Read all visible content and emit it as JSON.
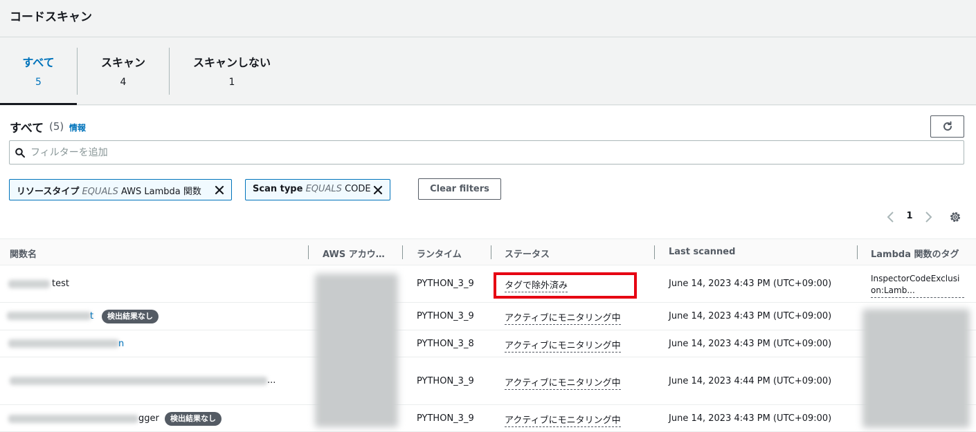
{
  "page": {
    "title": "コードスキャン"
  },
  "tabs": [
    {
      "label": "すべて",
      "count": "5"
    },
    {
      "label": "スキャン",
      "count": "4"
    },
    {
      "label": "スキャンしない",
      "count": "1"
    }
  ],
  "panel": {
    "title": "すべて",
    "count": "(5)",
    "info": "情報"
  },
  "search": {
    "placeholder": "フィルターを追加"
  },
  "filters": [
    {
      "key": "リソースタイプ",
      "op": "EQUALS",
      "value": "AWS Lambda 関数"
    },
    {
      "key": "Scan type",
      "op": "EQUALS",
      "value": "CODE"
    }
  ],
  "clear_filters": "Clear filters",
  "pagination": {
    "current": "1"
  },
  "columns": [
    "関数名",
    "AWS アカウ…",
    "ランタイム",
    "ステータス",
    "Last scanned",
    "Lambda 関数のタグ"
  ],
  "rows": [
    {
      "name": "test",
      "badge": "",
      "runtime": "PYTHON_3_9",
      "status": "タグで除外済み",
      "scanned": "June 14, 2023 4:43 PM (UTC+09:00)",
      "tag_line1": "InspectorCodeExclusi",
      "tag_line2": "on:Lamb..."
    },
    {
      "name": "t",
      "badge": "検出結果なし",
      "runtime": "PYTHON_3_9",
      "status": "アクティブにモニタリング中",
      "scanned": "June 14, 2023 4:43 PM (UTC+09:00)"
    },
    {
      "name": "n",
      "badge": "",
      "runtime": "PYTHON_3_8",
      "status": "アクティブにモニタリング中",
      "scanned": "June 14, 2023 4:43 PM (UTC+09:00)"
    },
    {
      "name": "...",
      "badge": "",
      "runtime": "PYTHON_3_9",
      "status": "アクティブにモニタリング中",
      "scanned": "June 14, 2023 4:44 PM (UTC+09:00)"
    },
    {
      "name": "gger",
      "badge": "検出結果なし",
      "runtime": "PYTHON_3_9",
      "status": "アクティブにモニタリング中",
      "scanned": "June 14, 2023 4:43 PM (UTC+09:00)"
    }
  ],
  "colors": {
    "link": "#0073bb",
    "highlight": "#e60012",
    "badge": "#545b64"
  }
}
